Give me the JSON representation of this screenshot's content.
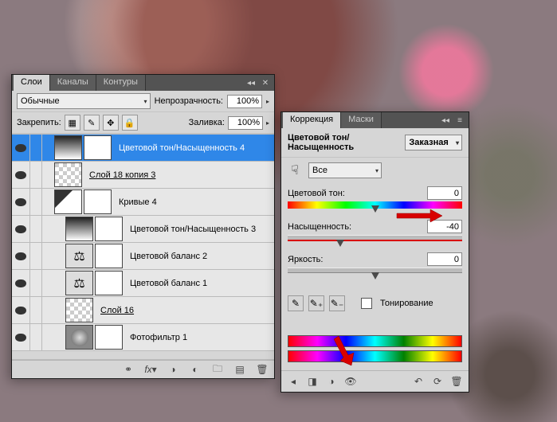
{
  "layers_panel": {
    "tabs": {
      "layers": "Слои",
      "channels": "Каналы",
      "paths": "Контуры"
    },
    "blend_mode": "Обычные",
    "opacity_label": "Непрозрачность:",
    "opacity_value": "100%",
    "lock_label": "Закрепить:",
    "fill_label": "Заливка:",
    "fill_value": "100%",
    "layers": [
      {
        "name": "Цветовой тон/Насыщенность 4"
      },
      {
        "name": "Слой 18 копия 3"
      },
      {
        "name": "Кривые 4"
      },
      {
        "name": "Цветовой тон/Насыщенность 3"
      },
      {
        "name": "Цветовой баланс 2"
      },
      {
        "name": "Цветовой баланс 1"
      },
      {
        "name": "Слой 16"
      },
      {
        "name": "Фотофильтр 1"
      }
    ]
  },
  "adjust_panel": {
    "tabs": {
      "adjust": "Коррекция",
      "masks": "Маски"
    },
    "title": "Цветовой тон/Насыщенность",
    "preset": "Заказная",
    "range": "Все",
    "hue_label": "Цветовой тон:",
    "hue_value": "0",
    "sat_label": "Насыщенность:",
    "sat_value": "-40",
    "light_label": "Яркость:",
    "light_value": "0",
    "colorize": "Тонирование"
  }
}
